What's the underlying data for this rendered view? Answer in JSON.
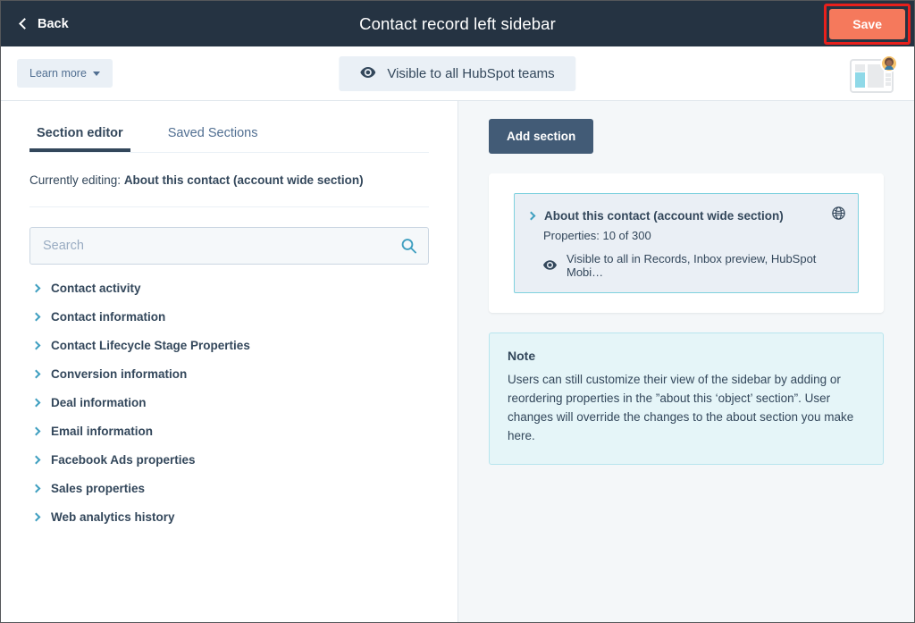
{
  "topbar": {
    "back_label": "Back",
    "title": "Contact record left sidebar",
    "save_label": "Save",
    "save_color": "#f5795c",
    "highlight_color": "#e8201c",
    "background": "#253342"
  },
  "subheader": {
    "learn_more_label": "Learn more",
    "visibility_label": "Visible to all HubSpot teams",
    "preview_thumb_name": "sidebar-layout-preview"
  },
  "left_pane": {
    "tabs": [
      {
        "label": "Section editor",
        "active": true
      },
      {
        "label": "Saved Sections",
        "active": false
      }
    ],
    "currently_editing_prefix": "Currently editing: ",
    "currently_editing_value": "About this contact (account wide section)",
    "search": {
      "placeholder": "Search",
      "value": ""
    },
    "groups": [
      {
        "label": "Contact activity"
      },
      {
        "label": "Contact information"
      },
      {
        "label": "Contact Lifecycle Stage Properties"
      },
      {
        "label": "Conversion information"
      },
      {
        "label": "Deal information"
      },
      {
        "label": "Email information"
      },
      {
        "label": "Facebook Ads properties"
      },
      {
        "label": "Sales properties"
      },
      {
        "label": "Web analytics history"
      }
    ]
  },
  "right_pane": {
    "add_section_label": "Add section",
    "section": {
      "title": "About this contact (account wide section)",
      "properties_label": "Properties: 10 of 300",
      "visibility_label": "Visible to all in Records, Inbox preview, HubSpot Mobi…",
      "accent_border": "#7fd1de"
    },
    "note": {
      "title": "Note",
      "body": "Users can still customize their view of the sidebar by adding or reordering properties in the ”about this ‘object’ section”. User changes will override the changes to the about section you make here."
    }
  }
}
